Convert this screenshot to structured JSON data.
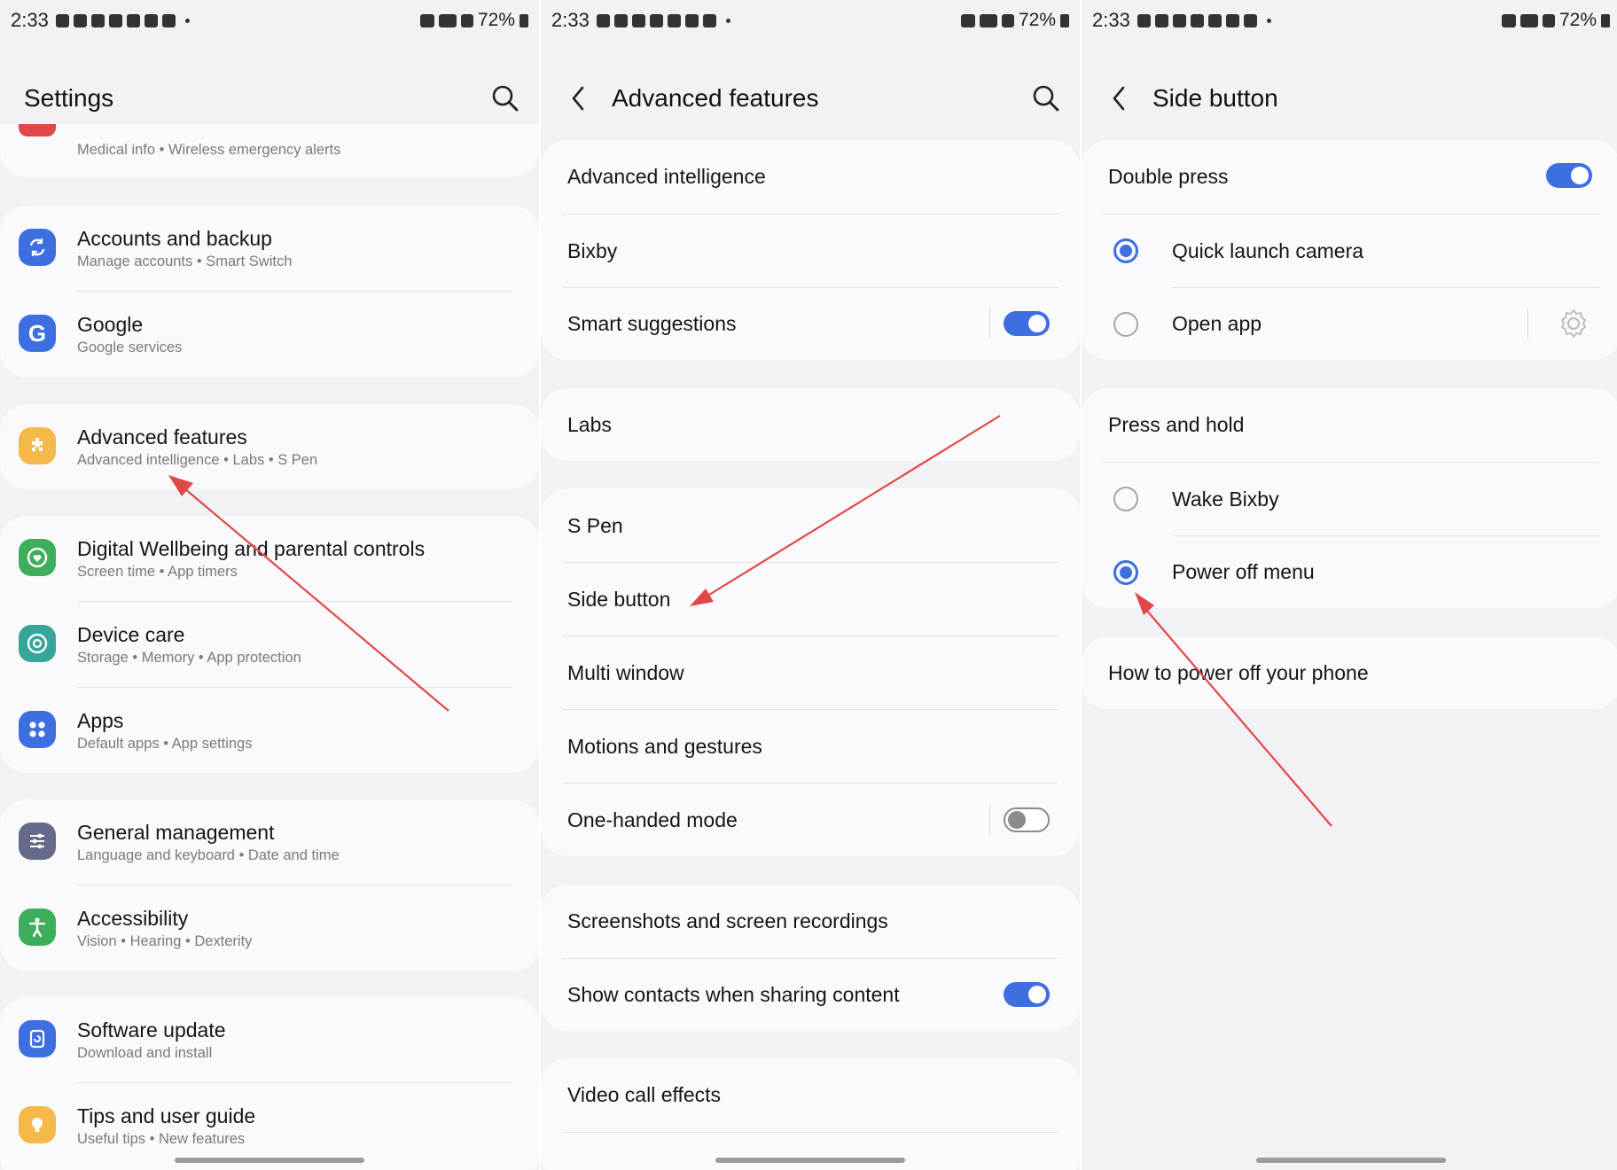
{
  "status_bar": {
    "screen1": {
      "time": "2:33",
      "battery": "72%"
    },
    "screen2": {
      "time": "2:33",
      "battery": "72%"
    },
    "screen3": {
      "time": "2:33",
      "battery": "72%"
    }
  },
  "settings": {
    "title": "Settings",
    "partial_subtitle": "Medical info  •  Wireless emergency alerts",
    "items": [
      {
        "title": "Accounts and backup",
        "subtitle": "Manage accounts  •  Smart Switch",
        "icon": "sync-icon",
        "color": "#3e6fe0"
      },
      {
        "title": "Google",
        "subtitle": "Google services",
        "icon": "google-g-icon",
        "color": "#3e6fe0"
      },
      {
        "title": "Advanced features",
        "subtitle": "Advanced intelligence  •  Labs  •  S Pen",
        "icon": "puzzle-icon",
        "color": "#f5b94a"
      },
      {
        "title": "Digital Wellbeing and parental controls",
        "subtitle": "Screen time  •  App timers",
        "icon": "heart-circle-icon",
        "color": "#3cae5c"
      },
      {
        "title": "Device care",
        "subtitle": "Storage  •  Memory  •  App protection",
        "icon": "device-care-icon",
        "color": "#36a59a"
      },
      {
        "title": "Apps",
        "subtitle": "Default apps  •  App settings",
        "icon": "apps-grid-icon",
        "color": "#3e6fe0"
      },
      {
        "title": "General management",
        "subtitle": "Language and keyboard  •  Date and time",
        "icon": "sliders-icon",
        "color": "#666a8a"
      },
      {
        "title": "Accessibility",
        "subtitle": "Vision  •  Hearing  •  Dexterity",
        "icon": "accessibility-icon",
        "color": "#3cae5c"
      },
      {
        "title": "Software update",
        "subtitle": "Download and install",
        "icon": "update-icon",
        "color": "#3e6fe0"
      },
      {
        "title": "Tips and user guide",
        "subtitle": "Useful tips  •  New features",
        "icon": "bulb-icon",
        "color": "#f5b94a"
      }
    ]
  },
  "advanced": {
    "title": "Advanced features",
    "items": [
      {
        "label": "Advanced intelligence"
      },
      {
        "label": "Bixby"
      },
      {
        "label": "Smart suggestions",
        "toggle": "on"
      },
      {
        "label": "Labs"
      },
      {
        "label": "S Pen"
      },
      {
        "label": "Side button"
      },
      {
        "label": "Multi window"
      },
      {
        "label": "Motions and gestures"
      },
      {
        "label": "One-handed mode",
        "toggle": "off"
      },
      {
        "label": "Screenshots and screen recordings"
      },
      {
        "label": "Show contacts when sharing content",
        "toggle": "on"
      },
      {
        "label": "Video call effects"
      }
    ]
  },
  "side_button": {
    "title": "Side button",
    "double_press": {
      "label": "Double press",
      "toggle": "on"
    },
    "double_options": [
      {
        "label": "Quick launch camera",
        "selected": true
      },
      {
        "label": "Open app",
        "selected": false
      }
    ],
    "press_hold": {
      "label": "Press and hold"
    },
    "hold_options": [
      {
        "label": "Wake Bixby",
        "selected": false
      },
      {
        "label": "Power off menu",
        "selected": true
      }
    ],
    "how_to": "How to power off your phone"
  },
  "colors": {
    "accent": "#3e6fe0",
    "background": "#f1f1f6",
    "card": "#fafafc",
    "annotation_arrow": "#e04848"
  }
}
